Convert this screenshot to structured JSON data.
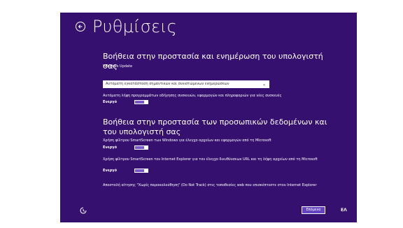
{
  "header": {
    "title": "Ρυθμίσεις"
  },
  "section1": {
    "heading": "Βοήθεια στην προστασία και ενημέρωση του υπολογιστή σας",
    "windows_update_label": "Windows Update",
    "update_select_value": "Αυτόματη εγκατάσταση σημαντικών και συνιστώμενων ενημερώσεων",
    "driver_text": "Αυτόματη λήψη προγραμμάτων οδήγησης συσκευών, εφαρμογών και πληροφοριών για νέες συσκευές",
    "driver_state": "Ενεργό",
    "driver_on": true
  },
  "section2": {
    "heading": "Βοήθεια στην προστασία των προσωπικών δεδομένων και του υπολογιστή σας",
    "smartscreen_windows_text": "Χρήση φίλτρου SmartScreen των Windows για έλεγχο αρχείων και εφαρμογών από τη Microsoft",
    "smartscreen_windows_state": "Ενεργό",
    "smartscreen_windows_on": true,
    "smartscreen_ie_text": "Χρήση φίλτρου SmartScreen του Internet Explorer για τον έλεγχο διευθύνσεων URL και τη λήψη αρχείων από τη Microsoft",
    "smartscreen_ie_state": "Ενεργό",
    "smartscreen_ie_on": true,
    "dnt_text": "Αποστολή αίτησης \"Χωρίς παρακολούθηση\" (Do Not Track) στις τοποθεσίες web που επισκέπτεστε στον Internet Explorer"
  },
  "footer": {
    "next_label": "Επόμενο",
    "language": "ΕΛ",
    "accessibility_icon": "ease-of-access-icon"
  },
  "colors": {
    "background": "#35106e",
    "toggle_fill": "#7a57c8",
    "button_fill": "#6644c0"
  }
}
